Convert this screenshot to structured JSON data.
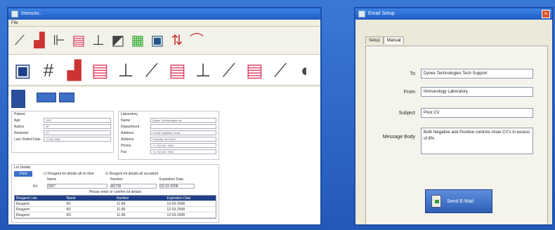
{
  "left_window": {
    "title": "Immuno..",
    "menu": "File",
    "toolbar1_icons": [
      "pipette-icon",
      "lab-rack-icon",
      "microscope-icon",
      "heater-icon",
      "balance-icon",
      "analyzer-icon",
      "report-icon",
      "display-icon",
      "sort-icon",
      "curve-icon"
    ],
    "toolbar2_icons": [
      "document-icon",
      "grid-icon",
      "lab-rack-icon",
      "heater-icon",
      "balance-icon",
      "pipette-icon",
      "heater-icon",
      "balance-icon",
      "pipette-icon",
      "heater-icon",
      "pipette-icon",
      "magnet-icon"
    ],
    "patient_panel": {
      "title": "Patient",
      "rows": [
        {
          "label": "Age",
          "value": "2007"
        },
        {
          "label": "Author",
          "value": "JP"
        },
        {
          "label": "Reviewer",
          "value": "VT"
        },
        {
          "label": "Last Visited Date",
          "value": "17-08-2006"
        }
      ]
    },
    "lab_panel": {
      "title": "Laboratory",
      "rows": [
        {
          "label": "Name",
          "value": "Dynex Technologies Inc"
        },
        {
          "label": "Department",
          "value": ""
        },
        {
          "label": "Address",
          "value": "14340 Sullyfield Circle"
        },
        {
          "label": "Address",
          "value": "Chantilly VA 20151"
        },
        {
          "label": "Phone",
          "value": "+1 703 631 7800"
        },
        {
          "label": "Fax",
          "value": "+1 703 631 7816"
        }
      ]
    },
    "controls_panel": {
      "title": "Lot Details",
      "button": "Print",
      "check1": "Reagent lot details all on time",
      "check2": "Reagent lot details all accepted",
      "col_name": "Name",
      "col_number": "Number",
      "col_expiry": "Expiration Date",
      "lot_label": "Kit",
      "lot_name": "2007",
      "lot_number": "A5735",
      "lot_expiry": "22-03-2008",
      "note": "Please enter or confirm lot details",
      "grid_headers": [
        "Reagent Lots",
        "Name",
        "Number",
        "Expiration Date"
      ],
      "grid_rows": [
        [
          "Reagent",
          "R1",
          "11-84",
          "12-03-2008"
        ],
        [
          "Reagent",
          "R2",
          "11-85",
          "12-03-2008"
        ],
        [
          "Reagent",
          "R3",
          "11-86",
          "12-03-2008"
        ]
      ]
    }
  },
  "right_window": {
    "title": "Email Setup",
    "tabs": [
      "Setup",
      "Manual"
    ],
    "active_tab": "Manual",
    "fields": {
      "to_label": "To",
      "to_value": "Dynex Technologies Tech Support",
      "from_label": "From",
      "from_value": "Immunology Laboratory",
      "subject_label": "Subject",
      "subject_value": "Poor CV",
      "body_label": "Message Body",
      "body_value": "Both Negative and Positive controls show CV's in excess of 8%"
    },
    "send_button": "Send E-Mail"
  }
}
